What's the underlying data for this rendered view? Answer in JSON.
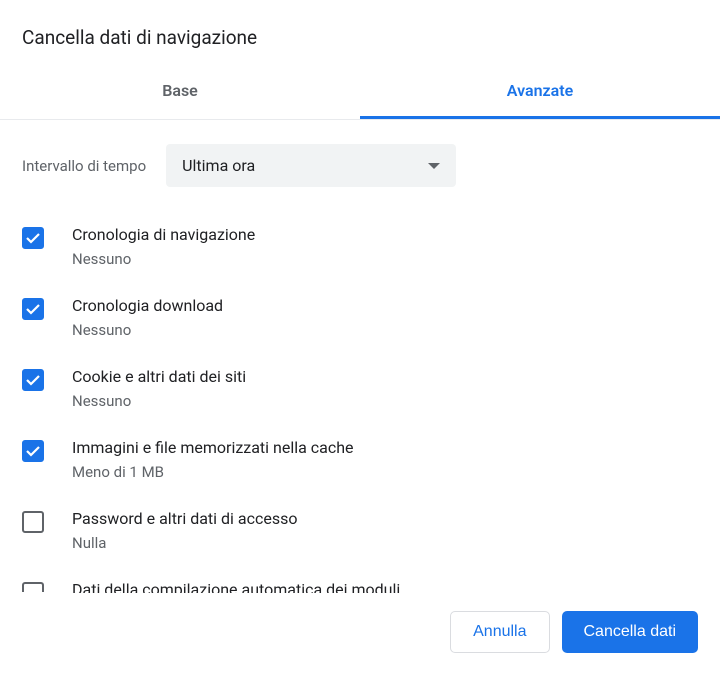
{
  "dialog": {
    "title": "Cancella dati di navigazione"
  },
  "tabs": {
    "basic": "Base",
    "advanced": "Avanzate"
  },
  "time_range": {
    "label": "Intervallo di tempo",
    "selected": "Ultima ora"
  },
  "items": [
    {
      "label": "Cronologia di navigazione",
      "sub": "Nessuno",
      "checked": true
    },
    {
      "label": "Cronologia download",
      "sub": "Nessuno",
      "checked": true
    },
    {
      "label": "Cookie e altri dati dei siti",
      "sub": "Nessuno",
      "checked": true
    },
    {
      "label": "Immagini e file memorizzati nella cache",
      "sub": "Meno di 1 MB",
      "checked": true
    },
    {
      "label": "Password e altri dati di accesso",
      "sub": "Nulla",
      "checked": false
    },
    {
      "label": "Dati della compilazione automatica dei moduli",
      "sub": "",
      "checked": false
    }
  ],
  "footer": {
    "cancel": "Annulla",
    "confirm": "Cancella dati"
  }
}
